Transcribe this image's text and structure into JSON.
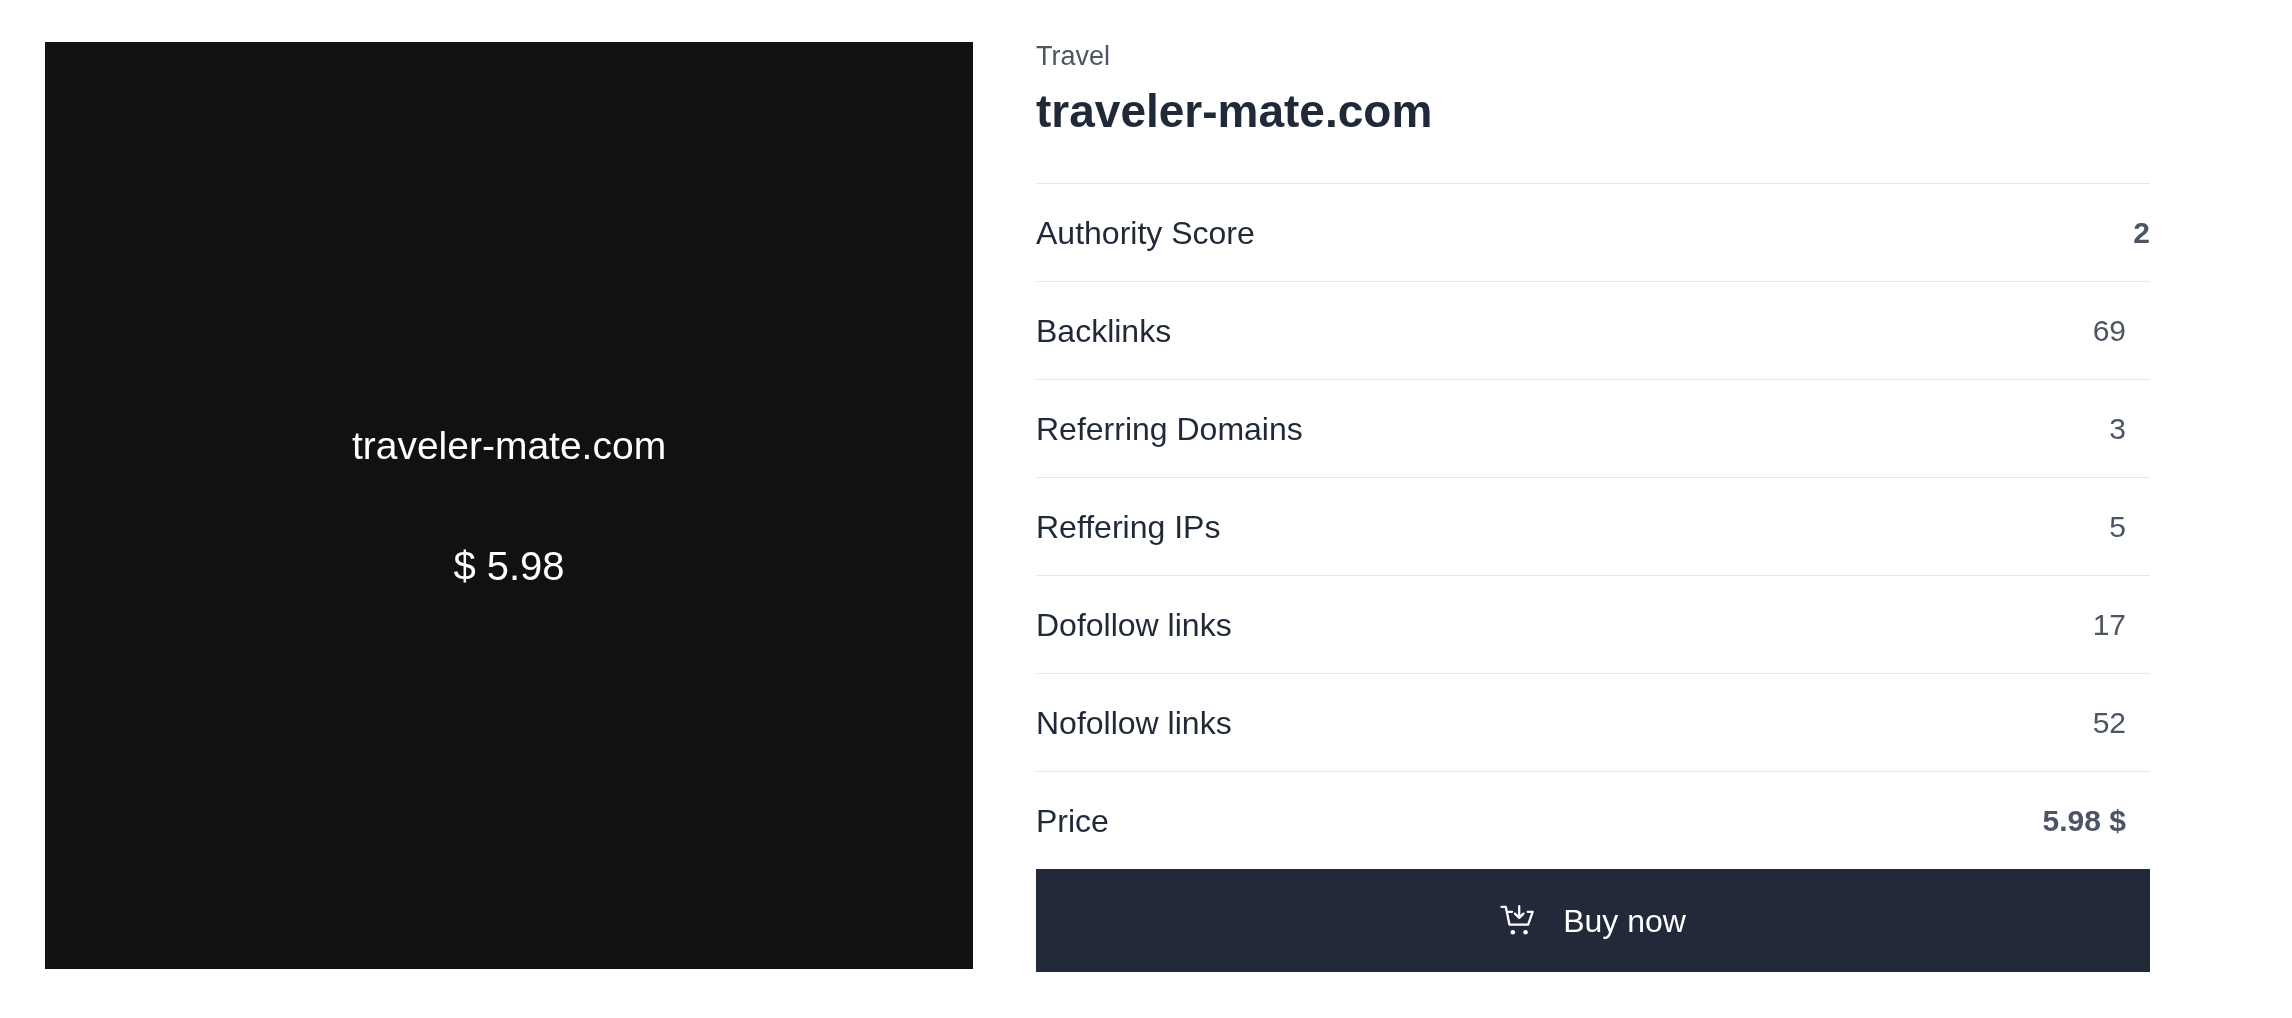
{
  "preview": {
    "domain": "traveler-mate.com",
    "price": "$ 5.98"
  },
  "details": {
    "category": "Travel",
    "title": "traveler-mate.com",
    "metrics": [
      {
        "kind": "score",
        "label": "Authority Score",
        "value": "2"
      },
      {
        "kind": "metric",
        "label": "Backlinks",
        "value": "69"
      },
      {
        "kind": "metric",
        "label": "Referring Domains",
        "value": "3"
      },
      {
        "kind": "metric",
        "label": "Reffering IPs",
        "value": "5"
      },
      {
        "kind": "metric",
        "label": "Dofollow links",
        "value": "17"
      },
      {
        "kind": "metric",
        "label": "Nofollow links",
        "value": "52"
      },
      {
        "kind": "price",
        "label": "Price",
        "value": "5.98 $"
      }
    ],
    "buy_button": {
      "label": "Buy now"
    }
  }
}
